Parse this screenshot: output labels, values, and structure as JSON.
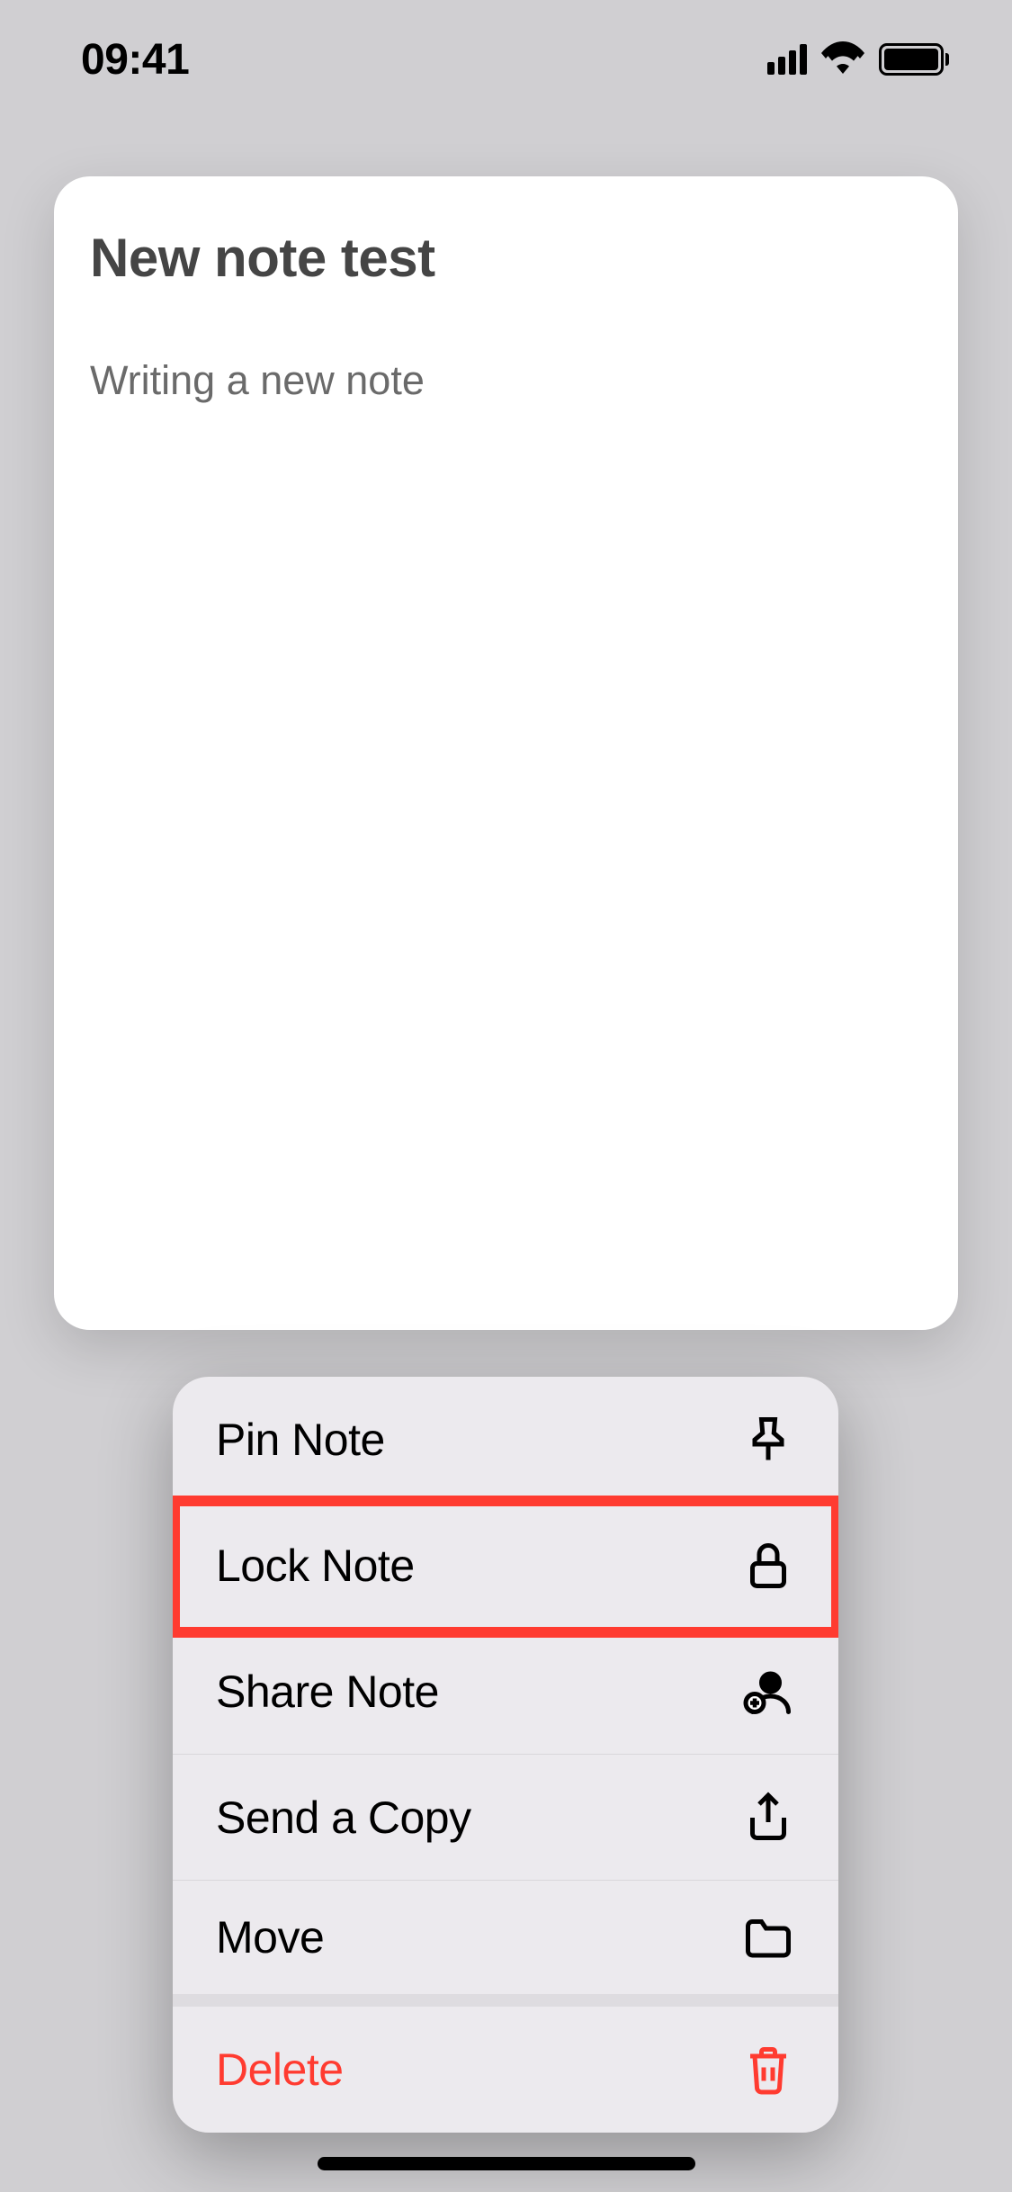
{
  "statusBar": {
    "time": "09:41"
  },
  "note": {
    "title": "New note test",
    "body": "Writing a new note"
  },
  "menu": {
    "items": [
      {
        "label": "Pin Note",
        "icon": "pin-icon",
        "destructive": false
      },
      {
        "label": "Lock Note",
        "icon": "lock-icon",
        "destructive": false,
        "highlighted": true
      },
      {
        "label": "Share Note",
        "icon": "person-add-icon",
        "destructive": false
      },
      {
        "label": "Send a Copy",
        "icon": "share-icon",
        "destructive": false
      },
      {
        "label": "Move",
        "icon": "folder-icon",
        "destructive": false,
        "separatorAfter": true
      },
      {
        "label": "Delete",
        "icon": "trash-icon",
        "destructive": true
      }
    ]
  }
}
